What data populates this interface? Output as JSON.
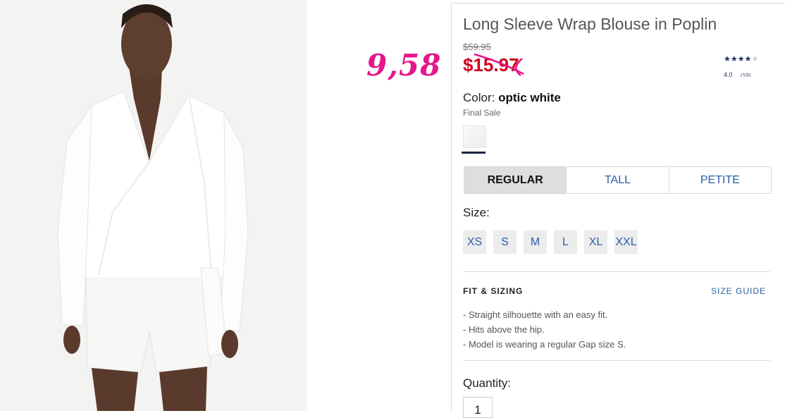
{
  "product": {
    "title": "Long Sleeve Wrap Blouse in Poplin",
    "original_price": "$59.95",
    "sale_price": "$15.97",
    "annotation": "9,58",
    "rating": {
      "stars_filled": 4,
      "stars_total": 5,
      "value": "4.0",
      "count": "(10)"
    },
    "color_label": "Color:",
    "color_value": "optic white",
    "final_sale": "Final Sale",
    "fit_tabs": [
      "REGULAR",
      "TALL",
      "PETITE"
    ],
    "selected_fit": "REGULAR",
    "size_label": "Size:",
    "sizes": [
      "XS",
      "S",
      "M",
      "L",
      "XL",
      "XXL"
    ],
    "fit_heading": "FIT & SIZING",
    "size_guide": "SIZE GUIDE",
    "fit_bullets": [
      "Straight silhouette with an easy fit.",
      "Hits above the hip.",
      "Model is wearing a regular Gap size S."
    ],
    "quantity_label": "Quantity:",
    "quantity_value": "1"
  },
  "colors": {
    "sale_red": "#d0021b",
    "annotation_pink": "#e5178c",
    "link_blue": "#2b5ea7",
    "navy": "#1a2440"
  }
}
